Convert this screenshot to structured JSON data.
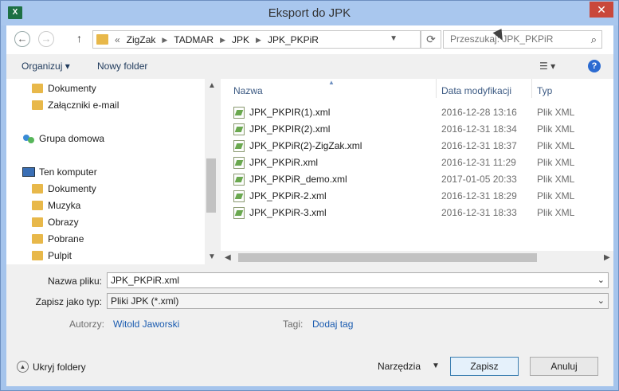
{
  "window": {
    "title": "Eksport do JPK",
    "app_icon": "excel-icon",
    "close_label": "✕"
  },
  "nav": {
    "back": "←",
    "forward": "→",
    "up": "↑",
    "crumb_prefix": "«",
    "crumbs": [
      "ZigZak",
      "TADMAR",
      "JPK",
      "JPK_PKPiR"
    ],
    "refresh": "⟳",
    "search_placeholder": "Przeszukaj: JPK_PKPiR"
  },
  "toolbar": {
    "organize": "Organizuj ▾",
    "new_folder": "Nowy folder",
    "view": "☰ ▾",
    "help": "?"
  },
  "tree": [
    {
      "label": "Dokumenty",
      "icon": "folder-icon"
    },
    {
      "label": "Załączniki e-mail",
      "icon": "folder-icon"
    },
    {
      "label": "Grupa domowa",
      "icon": "homegroup-icon"
    },
    {
      "label": "Ten komputer",
      "icon": "computer-icon"
    },
    {
      "label": "Dokumenty",
      "icon": "folder-icon"
    },
    {
      "label": "Muzyka",
      "icon": "folder-icon"
    },
    {
      "label": "Obrazy",
      "icon": "folder-icon"
    },
    {
      "label": "Pobrane",
      "icon": "folder-icon"
    },
    {
      "label": "Pulpit",
      "icon": "folder-icon"
    }
  ],
  "columns": {
    "name": "Nazwa",
    "date": "Data modyfikacji",
    "type": "Typ"
  },
  "files": [
    {
      "name": "JPK_PKPIR(1).xml",
      "date": "2016-12-28 13:16",
      "type": "Plik XML"
    },
    {
      "name": "JPK_PKPIR(2).xml",
      "date": "2016-12-31 18:34",
      "type": "Plik XML"
    },
    {
      "name": "JPK_PKPiR(2)-ZigZak.xml",
      "date": "2016-12-31 18:37",
      "type": "Plik XML"
    },
    {
      "name": "JPK_PKPiR.xml",
      "date": "2016-12-31 11:29",
      "type": "Plik XML"
    },
    {
      "name": "JPK_PKPiR_demo.xml",
      "date": "2017-01-05 20:33",
      "type": "Plik XML"
    },
    {
      "name": "JPK_PKPiR-2.xml",
      "date": "2016-12-31 18:29",
      "type": "Plik XML"
    },
    {
      "name": "JPK_PKPiR-3.xml",
      "date": "2016-12-31 18:33",
      "type": "Plik XML"
    }
  ],
  "form": {
    "filename_label": "Nazwa pliku:",
    "filename_value": "JPK_PKPiR.xml",
    "type_label": "Zapisz jako typ:",
    "type_value": "Pliki JPK (*.xml)",
    "authors_label": "Autorzy:",
    "authors_value": "Witold Jaworski",
    "tags_label": "Tagi:",
    "tags_value": "Dodaj tag"
  },
  "footer": {
    "hide_folders": "Ukryj foldery",
    "tools": "Narzędzia",
    "save": "Zapisz",
    "cancel": "Anuluj"
  }
}
